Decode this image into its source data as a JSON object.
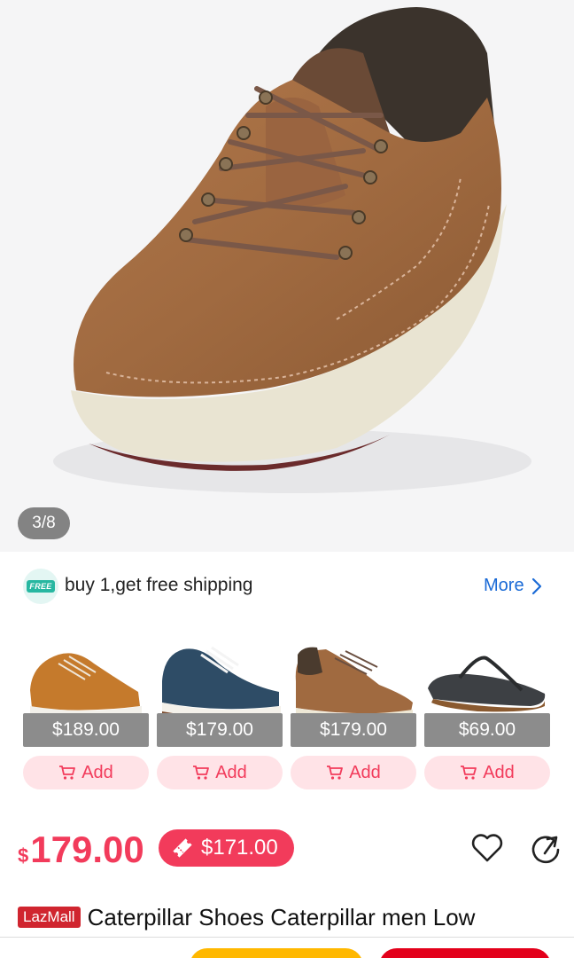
{
  "gallery": {
    "counter": "3/8"
  },
  "promo": {
    "badge": "FREE",
    "text": "buy 1,get free shipping",
    "more_label": "More"
  },
  "recommendations": [
    {
      "price": "$189.00",
      "add_label": "Add",
      "shoe": "tan-hiker-sneaker"
    },
    {
      "price": "$179.00",
      "add_label": "Add",
      "shoe": "navy-suede-sneaker"
    },
    {
      "price": "$179.00",
      "add_label": "Add",
      "shoe": "brown-leather-sneaker"
    },
    {
      "price": "$69.00",
      "add_label": "Add",
      "shoe": "black-flip-flop"
    }
  ],
  "product": {
    "currency": "$",
    "price": "179.00",
    "voucher_price": "$171.00",
    "badge": "LazMall",
    "title": "Caterpillar Shoes Caterpillar men Low"
  },
  "colors": {
    "accent": "#f23b5b",
    "link": "#1a6ad6",
    "price_tag": "#8c8c8c",
    "lazmall": "#d0252f",
    "buy_now": "#ffb800",
    "add_to_cart": "#e3001b"
  },
  "icons": [
    "free-shipping-icon",
    "chevron-right-icon",
    "cart-icon",
    "ticket-icon",
    "heart-icon",
    "share-icon"
  ]
}
